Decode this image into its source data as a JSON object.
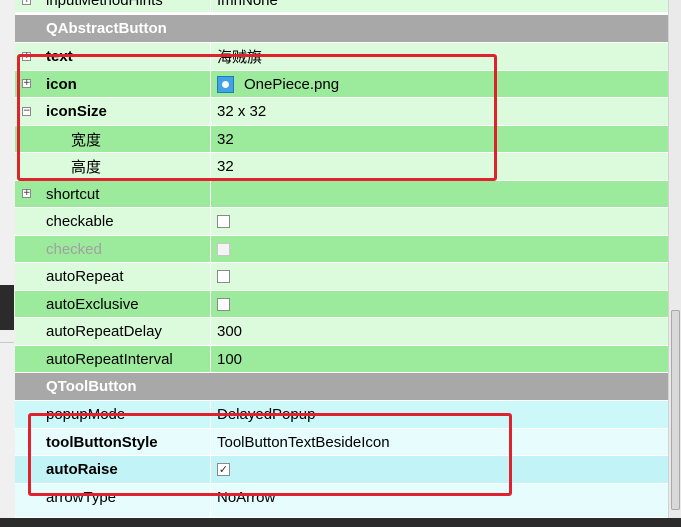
{
  "properties": [
    {
      "name": "inputMethodHints",
      "value": "ImhNone",
      "expander": "+"
    },
    {
      "section": "QAbstractButton"
    },
    {
      "name": "text",
      "value": "海贼旗",
      "expander": "+"
    },
    {
      "name": "icon",
      "value": "OnePiece.png",
      "expander": "+"
    },
    {
      "name": "iconSize",
      "value": "32 x 32",
      "expander": "−"
    },
    {
      "name": "宽度",
      "value": "32"
    },
    {
      "name": "高度",
      "value": "32"
    },
    {
      "name": "shortcut",
      "value": "",
      "expander": "+"
    },
    {
      "name": "checkable",
      "value": ""
    },
    {
      "name": "checked",
      "value": ""
    },
    {
      "name": "autoRepeat",
      "value": ""
    },
    {
      "name": "autoExclusive",
      "value": ""
    },
    {
      "name": "autoRepeatDelay",
      "value": "300"
    },
    {
      "name": "autoRepeatInterval",
      "value": "100"
    },
    {
      "section": "QToolButton"
    },
    {
      "name": "popupMode",
      "value": "DelayedPopup"
    },
    {
      "name": "toolButtonStyle",
      "value": "ToolButtonTextBesideIcon"
    },
    {
      "name": "autoRaise",
      "value": "✓"
    },
    {
      "name": "arrowType",
      "value": "NoArrow"
    }
  ],
  "colors": {
    "section_bg": "#a8a8a8",
    "green_dark": "#9ceb9c",
    "green_light": "#dcfadc",
    "cyan_light": "#cdf8fa",
    "highlight": "#e0212e"
  },
  "icons": {
    "expand": "plus-box-icon",
    "collapse": "minus-box-icon",
    "file": "image-file-icon",
    "checkbox": "checkbox-icon"
  }
}
